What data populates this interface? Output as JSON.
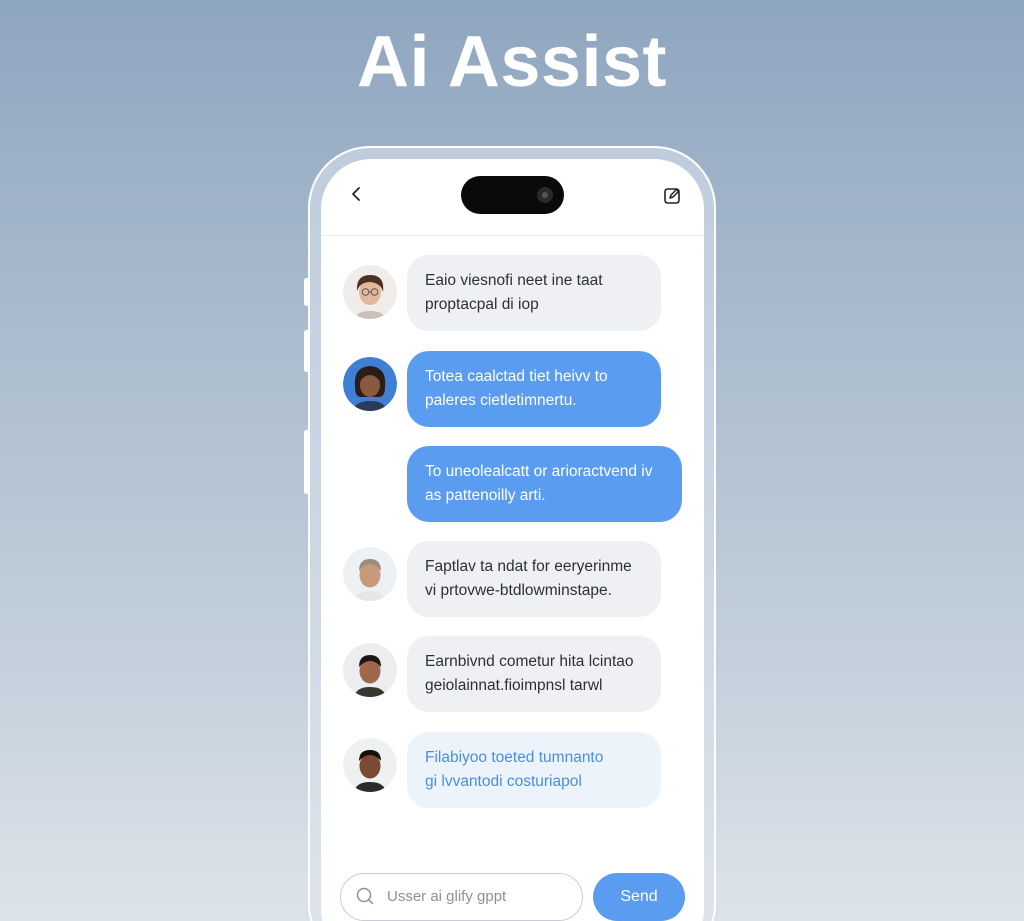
{
  "header": {
    "title": "Ai Assist"
  },
  "topbar": {
    "back_icon": "chevron-left-icon",
    "compose_icon": "compose-icon"
  },
  "messages": [
    {
      "style": "gray",
      "avatar": "avatar-1",
      "lines": [
        "Eaio viesnofi neet ine taat",
        "proptacpal di iop"
      ]
    },
    {
      "style": "blue",
      "avatar": "avatar-2",
      "lines": [
        "Totea caalctad tiet heivv to",
        "paleres cietletimnertu."
      ]
    },
    {
      "style": "blue",
      "avatar": null,
      "lines": [
        "To uneolealcatt or arioractvend iv",
        "as pattenoilly arti."
      ]
    },
    {
      "style": "gray",
      "avatar": "avatar-3",
      "lines": [
        "Faptlav ta ndat for eeryerinme",
        "vi prtovwe-btdlowminstape."
      ]
    },
    {
      "style": "gray",
      "avatar": "avatar-4",
      "lines": [
        "Earnbivnd cometur hita lcintao",
        "geiolainnat.fioimpnsl tarwl"
      ]
    },
    {
      "style": "light",
      "avatar": "avatar-5",
      "lines": [
        "Filabiyoo toeted tumnanto",
        "gi lvvantodi costuriapol"
      ]
    }
  ],
  "composer": {
    "input_text": "Usser ai glify gppt",
    "send_label": "Send",
    "search_icon": "search-icon"
  },
  "colors": {
    "accent": "#5a9cf0",
    "bubble_gray": "#eef0f3",
    "bubble_light": "#edf3fb"
  }
}
